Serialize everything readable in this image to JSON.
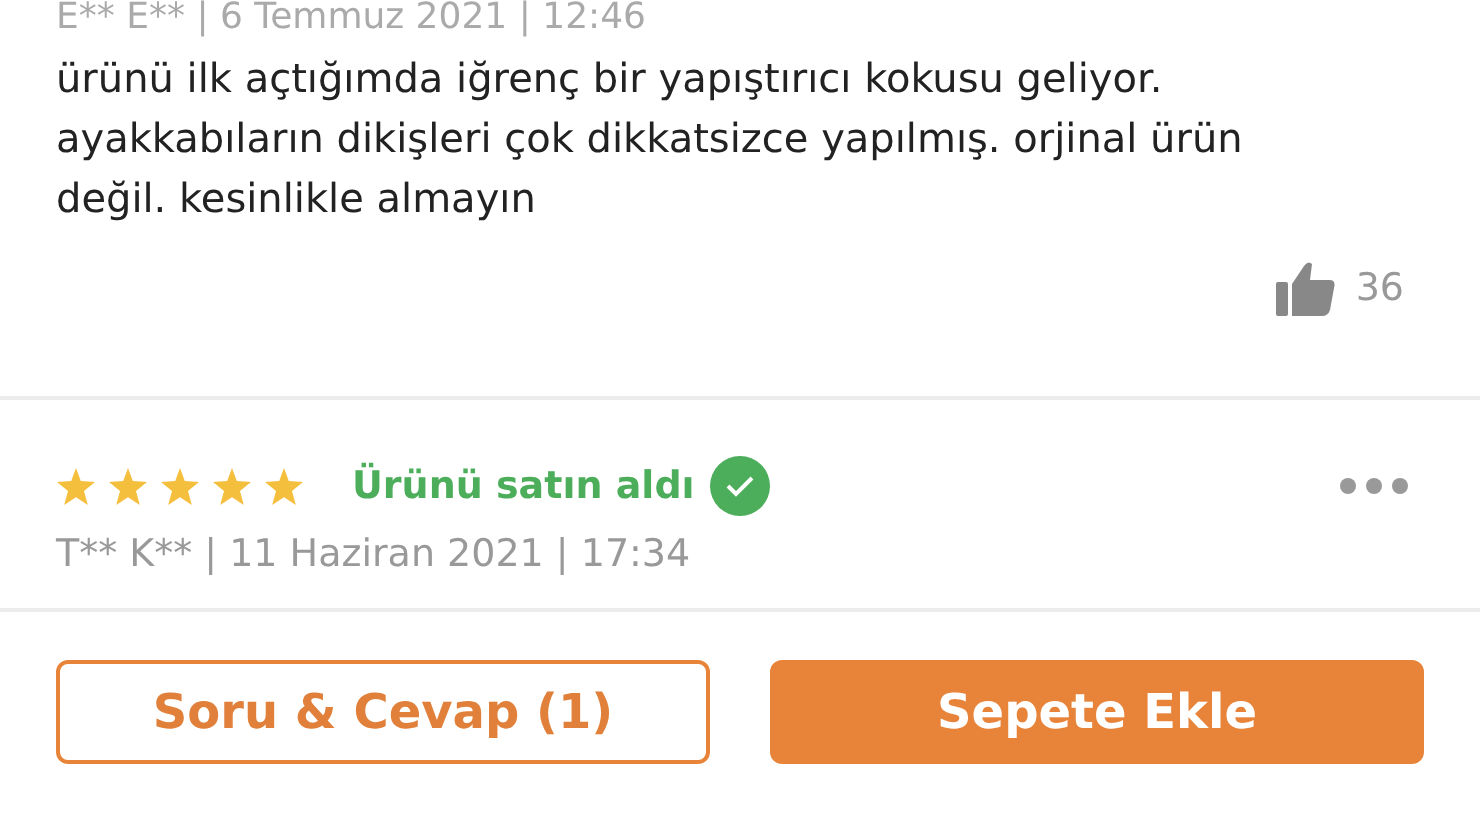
{
  "reviews": [
    {
      "meta": "E** E** | 6 Temmuz 2021 | 12:46",
      "text": "ürünü ilk açtığımda iğrenç bir yapıştırıcı kokusu geliyor. ayakkabıların dikişleri çok dikkatsizce yapılmış. orjinal ürün değil. kesinlikle almayın",
      "likes": "36"
    },
    {
      "stars": 5,
      "purchase_label": "Ürünü satın aldı",
      "verified": true,
      "meta": "T** K** | 11 Haziran 2021 | 17:34"
    }
  ],
  "buttons": [
    {
      "label": "Soru & Cevap (1)",
      "kind": "outline"
    },
    {
      "label": "Sepete Ekle",
      "kind": "filled"
    }
  ]
}
